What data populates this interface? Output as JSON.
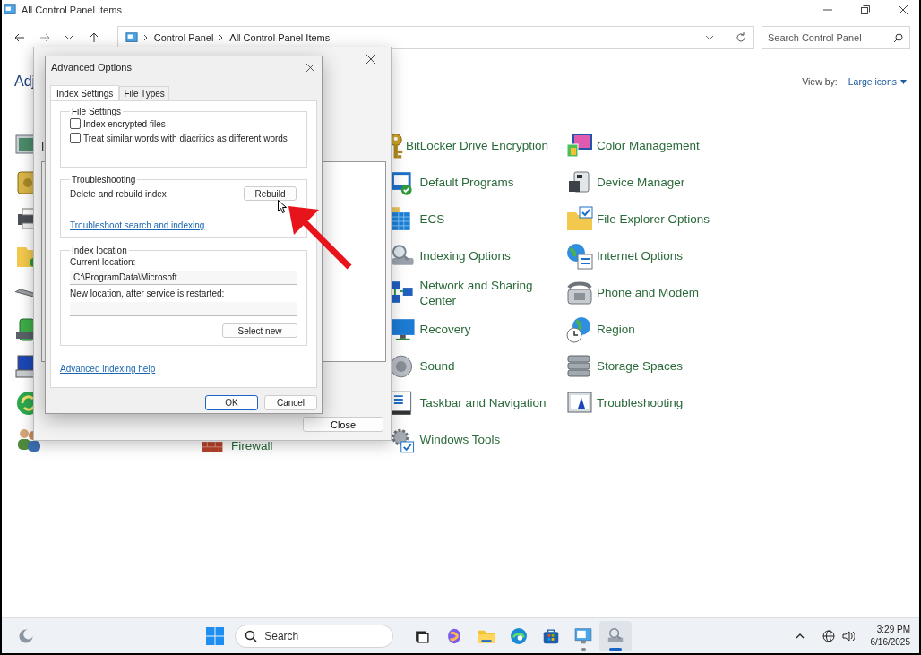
{
  "window": {
    "title": "All Control Panel Items"
  },
  "address_bar": {
    "path": [
      "Control Panel",
      "All Control Panel Items"
    ]
  },
  "search": {
    "placeholder": "Search Control Panel"
  },
  "heading": "Adj",
  "view_by": {
    "label": "View by:",
    "value": "Large icons"
  },
  "item_columns": [
    {
      "items": [
        {
          "label": "BitLocker Drive Encryption"
        },
        {
          "label": "Default Programs"
        },
        {
          "label": "ECS"
        },
        {
          "label": "Indexing Options"
        },
        {
          "label": "Network and Sharing Center"
        },
        {
          "label": "Recovery"
        },
        {
          "label": "Sound"
        },
        {
          "label": "Taskbar and Navigation"
        },
        {
          "label": "Windows Tools"
        }
      ]
    },
    {
      "items": [
        {
          "label": "Color Management"
        },
        {
          "label": "Device Manager"
        },
        {
          "label": "File Explorer Options"
        },
        {
          "label": "Internet Options"
        },
        {
          "label": "Phone and Modem"
        },
        {
          "label": "Region"
        },
        {
          "label": "Storage Spaces"
        },
        {
          "label": "Troubleshooting"
        }
      ]
    }
  ],
  "partly_hidden_items": [
    {
      "label": "Firewall"
    }
  ],
  "indexing_window": {
    "fragment": "I",
    "close_button": "Close"
  },
  "advanced_options": {
    "title": "Advanced Options",
    "tabs": [
      {
        "label": "Index Settings",
        "selected": true
      },
      {
        "label": "File Types",
        "selected": false
      }
    ],
    "file_settings": {
      "title": "File Settings",
      "options": [
        {
          "label": "Index encrypted files",
          "checked": false
        },
        {
          "label": "Treat similar words with diacritics as different words",
          "checked": false
        }
      ]
    },
    "troubleshooting": {
      "title": "Troubleshooting",
      "text": "Delete and rebuild index",
      "button": "Rebuild",
      "link": "Troubleshoot search and indexing"
    },
    "index_location": {
      "title": "Index location",
      "current_label": "Current location:",
      "current_value": "C:\\ProgramData\\Microsoft",
      "new_label": "New location, after service is restarted:",
      "button": "Select new"
    },
    "help_link": "Advanced indexing help",
    "buttons": [
      "OK",
      "Cancel"
    ]
  },
  "taskbar": {
    "search_placeholder": "Search",
    "time": "3:29 PM",
    "date": "6/16/2025",
    "apps": [
      {
        "open": false,
        "active": false
      },
      {
        "open": false,
        "active": false
      },
      {
        "open": false,
        "active": false
      },
      {
        "open": false,
        "active": false
      },
      {
        "open": false,
        "active": false
      },
      {
        "open": true,
        "active": false
      },
      {
        "open": true,
        "active": true
      }
    ]
  }
}
